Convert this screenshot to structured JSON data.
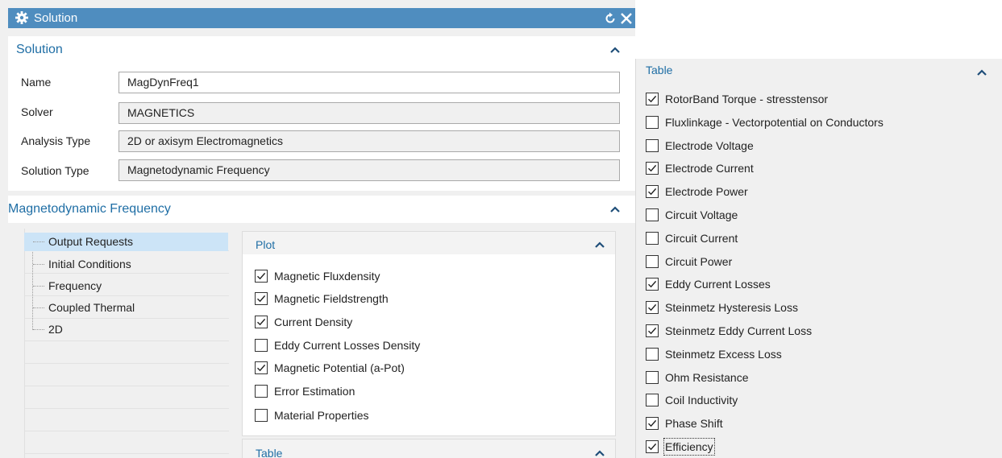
{
  "window": {
    "title": "Solution",
    "icons": {
      "settings": "gear-icon",
      "reset": "reset-icon",
      "close": "close-icon"
    }
  },
  "solution_section": {
    "title": "Solution",
    "fields": [
      {
        "label": "Name",
        "value": "MagDynFreq1",
        "editable": true
      },
      {
        "label": "Solver",
        "value": "MAGNETICS",
        "editable": false
      },
      {
        "label": "Analysis Type",
        "value": "2D or axisym Electromagnetics",
        "editable": false
      },
      {
        "label": "Solution Type",
        "value": "Magnetodynamic Frequency",
        "editable": false
      }
    ]
  },
  "magdyn_section": {
    "title": "Magnetodynamic Frequency",
    "tree": [
      {
        "label": "Output Requests",
        "selected": true
      },
      {
        "label": "Initial Conditions",
        "selected": false
      },
      {
        "label": "Frequency",
        "selected": false
      },
      {
        "label": "Coupled Thermal",
        "selected": false
      },
      {
        "label": "2D",
        "selected": false
      }
    ]
  },
  "plot_group": {
    "title": "Plot",
    "items": [
      {
        "label": "Magnetic Fluxdensity",
        "checked": true
      },
      {
        "label": "Magnetic Fieldstrength",
        "checked": true
      },
      {
        "label": "Current Density",
        "checked": true
      },
      {
        "label": "Eddy Current Losses Density",
        "checked": false
      },
      {
        "label": "Magnetic Potential (a-Pot)",
        "checked": true
      },
      {
        "label": "Error Estimation",
        "checked": false
      },
      {
        "label": "Material Properties",
        "checked": false
      }
    ]
  },
  "table_group_collapsed": {
    "title": "Table"
  },
  "table_panel": {
    "title": "Table",
    "items": [
      {
        "label": "RotorBand Torque - stresstensor",
        "checked": true
      },
      {
        "label": "Fluxlinkage - Vectorpotential on Conductors",
        "checked": false
      },
      {
        "label": "Electrode Voltage",
        "checked": false
      },
      {
        "label": "Electrode Current",
        "checked": true
      },
      {
        "label": "Electrode Power",
        "checked": true
      },
      {
        "label": "Circuit Voltage",
        "checked": false
      },
      {
        "label": "Circuit Current",
        "checked": false
      },
      {
        "label": "Circuit Power",
        "checked": false
      },
      {
        "label": "Eddy Current Losses",
        "checked": true
      },
      {
        "label": "Steinmetz Hysteresis Loss",
        "checked": true
      },
      {
        "label": "Steinmetz Eddy Current Loss",
        "checked": true
      },
      {
        "label": "Steinmetz Excess Loss",
        "checked": false
      },
      {
        "label": "Ohm Resistance",
        "checked": false
      },
      {
        "label": "Coil Inductivity",
        "checked": false
      },
      {
        "label": "Phase Shift",
        "checked": true
      },
      {
        "label": "Efficiency",
        "checked": true,
        "focused": true
      }
    ]
  },
  "colors": {
    "titlebar": "#4f8dbf",
    "section_title": "#1f6ea5",
    "selection": "#cce4f7"
  }
}
